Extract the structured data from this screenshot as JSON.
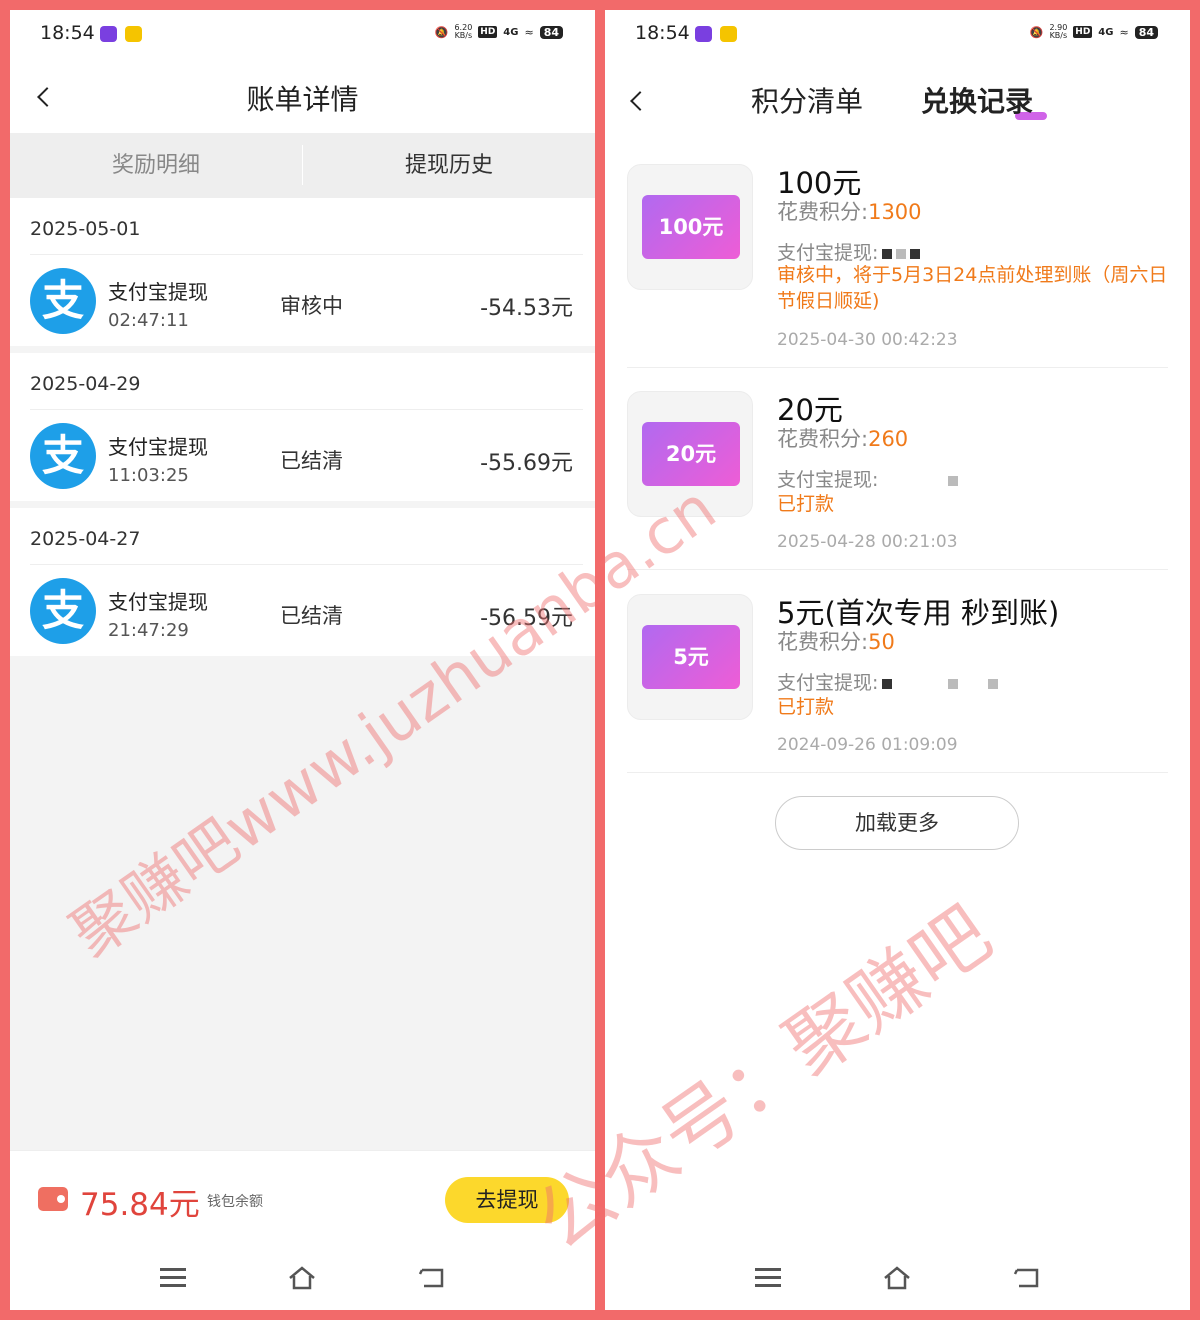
{
  "status_bar": {
    "time": "18:54",
    "left_speed": "6.20",
    "right_speed": "2.90",
    "speed_unit": "KB/s",
    "hd": "HD",
    "signal": "4G",
    "battery": "84"
  },
  "left": {
    "title": "账单详情",
    "tabs": [
      "奖励明细",
      "提现历史"
    ],
    "groups": [
      {
        "date": "2025-05-01",
        "title": "支付宝提现",
        "time": "02:47:11",
        "status": "审核中",
        "amount": "-54.53元"
      },
      {
        "date": "2025-04-29",
        "title": "支付宝提现",
        "time": "11:03:25",
        "status": "已结清",
        "amount": "-55.69元"
      },
      {
        "date": "2025-04-27",
        "title": "支付宝提现",
        "time": "21:47:29",
        "status": "已结清",
        "amount": "-56.59元"
      }
    ],
    "balance": "75.84元",
    "balance_label": "钱包余额",
    "withdraw_button": "去提现"
  },
  "right": {
    "tabs": [
      "积分清单",
      "兑换记录"
    ],
    "points_label": "花费积分:",
    "alipay_label": "支付宝提现:",
    "items": [
      {
        "badge": "100元",
        "title": "100元",
        "points": "1300",
        "state": "审核中，将于5月3日24点前处理到账（周六日节假日顺延)",
        "date": "2025-04-30 00:42:23"
      },
      {
        "badge": "20元",
        "title": "20元",
        "points": "260",
        "state": "已打款",
        "date": "2025-04-28 00:21:03"
      },
      {
        "badge": "5元",
        "title": "5元(首次专用 秒到账)",
        "points": "50",
        "state": "已打款",
        "date": "2024-09-26 01:09:09"
      }
    ],
    "load_more": "加载更多"
  },
  "watermarks": [
    "聚赚吧www.juzhuanba.cn",
    "公众号：聚赚吧"
  ],
  "colors": {
    "frame": "#f26a6a",
    "alipay_blue": "#1e9fe8",
    "balance_red": "#e0443c",
    "button_yellow": "#fcd82c",
    "points_orange": "#f07a1a",
    "tab_purple": "#d063e8"
  }
}
